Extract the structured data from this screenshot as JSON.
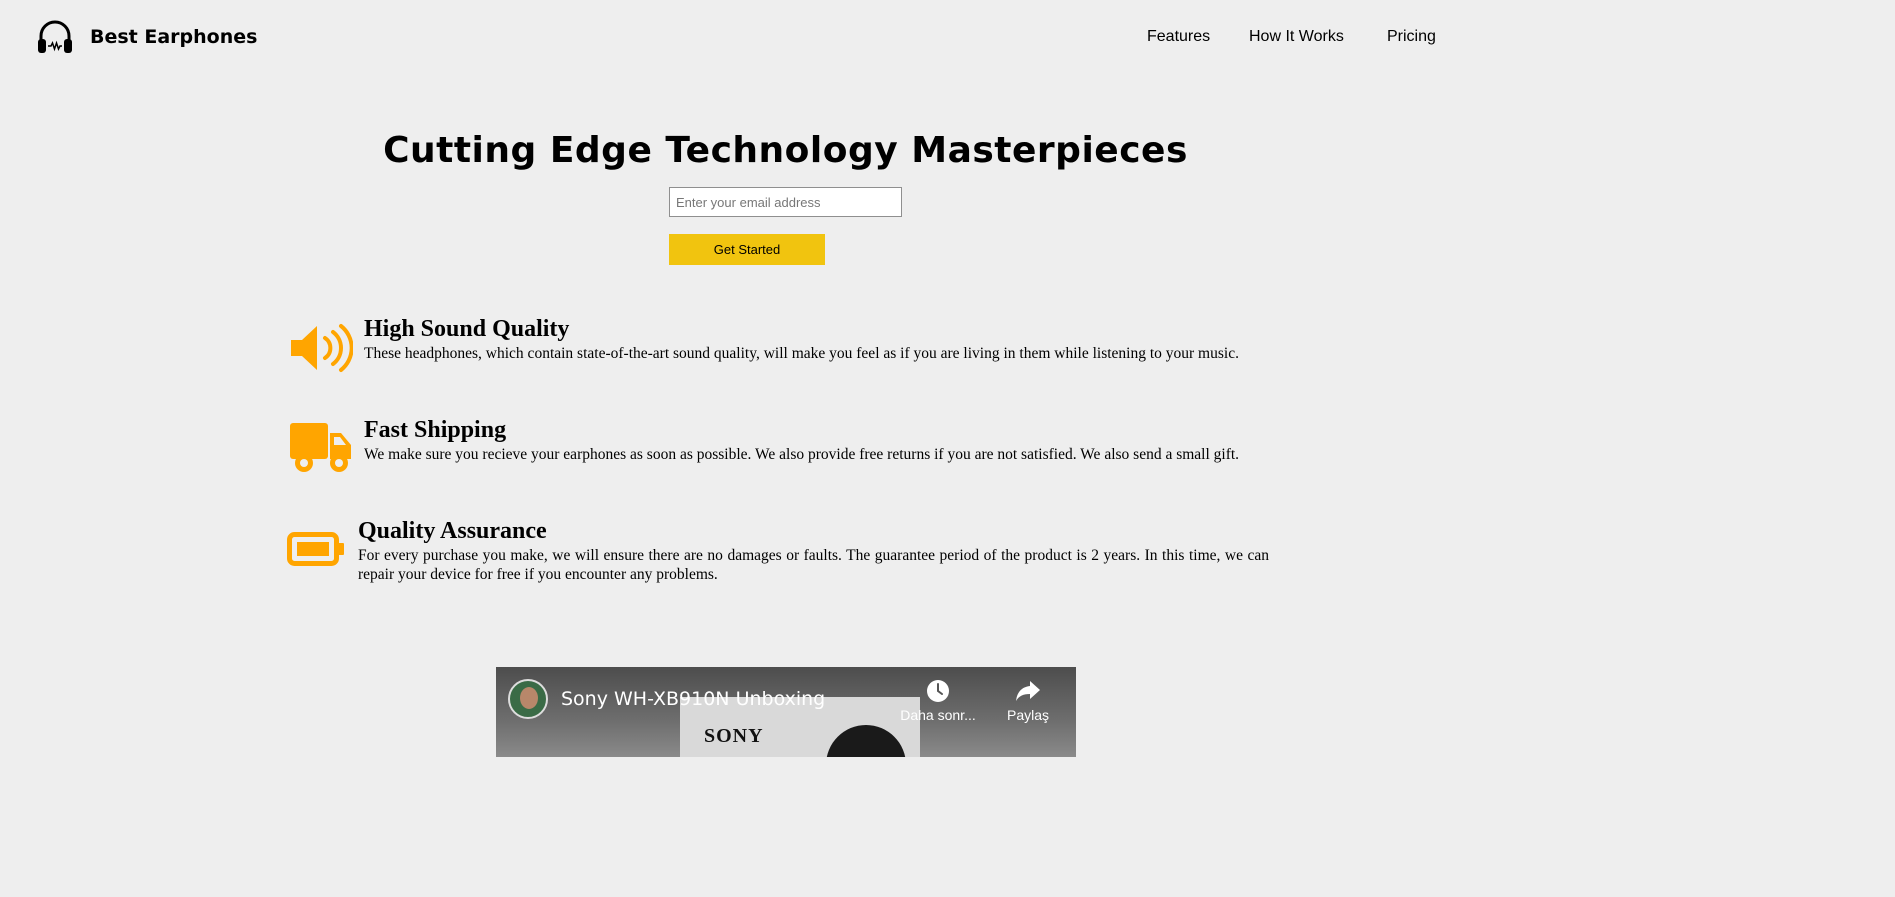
{
  "header": {
    "logo_icon": "headphones-icon",
    "brand": "Best Earphones",
    "nav": {
      "features": "Features",
      "how_it_works": "How It Works",
      "pricing": "Pricing"
    }
  },
  "hero": {
    "title": "Cutting Edge Technology Masterpieces",
    "email_placeholder": "Enter your email address",
    "cta_label": "Get Started"
  },
  "features": [
    {
      "icon": "speaker-volume-icon",
      "title": "High Sound Quality",
      "text": "These headphones, which contain state-of-the-art sound quality, will make you feel as if you are living in them while listening to your music."
    },
    {
      "icon": "truck-icon",
      "title": "Fast Shipping",
      "text": "We make sure you recieve your earphones as soon as possible. We also provide free returns if you are not satisfied. We also send a small gift."
    },
    {
      "icon": "battery-icon",
      "title": "Quality Assurance",
      "text": "For every purchase you make, we will ensure there are no damages or faults. The guarantee period of the product is 2 years. In this time, we can repair your device for free if you encounter any problems."
    }
  ],
  "video": {
    "title": "Sony WH-XB910N Unboxing",
    "brand_text": "SONY",
    "watch_later_label": "Daha sonr...",
    "share_label": "Paylaş"
  },
  "colors": {
    "background": "#eeeeee",
    "accent_button": "#f1c40f",
    "icon_orange": "#ffa500"
  }
}
